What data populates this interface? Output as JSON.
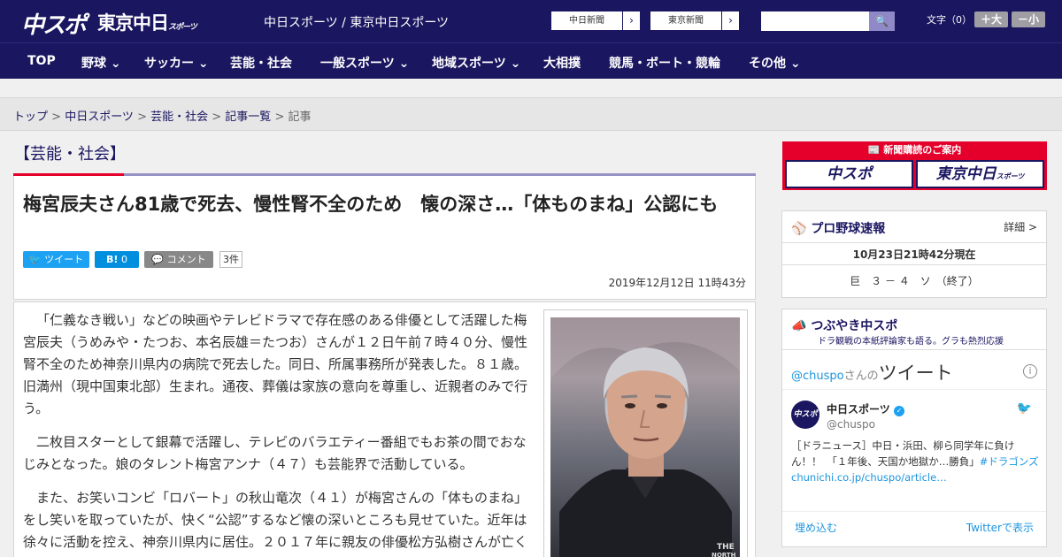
{
  "header": {
    "logo_main": "中スポ",
    "logo_tokyo": "東京中日",
    "logo_tokyo_sub": "スポーツ",
    "site_name": "中日スポーツ / 東京中日スポーツ",
    "paper1": "中日新聞",
    "paper2": "東京新聞",
    "paper_arrow": "›",
    "search_icon": "🔍",
    "font_label": "文字（0）",
    "font_plus": "＋大",
    "font_minus": "－小"
  },
  "nav": {
    "items": [
      "TOP",
      "野球",
      "サッカー",
      "芸能・社会",
      "一般スポーツ",
      "地域スポーツ",
      "大相撲",
      "競馬・ボート・競輪",
      "その他"
    ],
    "chevron": "⌄"
  },
  "breadcrumb": {
    "items": [
      "トップ",
      "中日スポーツ",
      "芸能・社会",
      "記事一覧"
    ],
    "separator": " > ",
    "current": "記事"
  },
  "article": {
    "category": "【芸能・社会】",
    "title": "梅宮辰夫さん81歳で死去、慢性腎不全のため　懐の深さ…「体ものまね」公認にも",
    "tweet_label": "ツイート",
    "hatena_label": "B!",
    "hatena_count": "0",
    "comment_label": "コメント",
    "comment_count": "3件",
    "date": "2019年12月12日 11時43分",
    "paragraphs": [
      "「仁義なき戦い」などの映画やテレビドラマで存在感のある俳優として活躍した梅宮辰夫（うめみや・たつお、本名辰雄＝たつお）さんが１２日午前７時４０分、慢性腎不全のため神奈川県内の病院で死去した。同日、所属事務所が発表した。８１歳。旧満州（現中国東北部）生まれ。通夜、葬儀は家族の意向を尊重し、近親者のみで行う。",
      "二枚目スターとして銀幕で活躍し、テレビのバラエティー番組でもお茶の間でおなじみとなった。娘のタレント梅宮アンナ（４７）も芸能界で活動している。",
      "また、お笑いコンビ「ロバート」の秋山竜次（４１）が梅宮さんの「体ものまね」をし笑いを取っていたが、快く“公認”するなど懐の深いところも見せていた。近年は徐々に活動を控え、神奈川県内に居住。２０１７年に親友の俳優松方弘樹さんが亡くなった時も自宅近くで報道陣の取材に応じ、涙ながらに思い出を語った。"
    ]
  },
  "sidebar": {
    "promo_header": "新聞購読のご案内",
    "promo1": "中スポ",
    "promo2": "東京中日",
    "promo2_sub": "スポーツ",
    "baseball": {
      "title": "プロ野球速報",
      "detail": "詳細 >",
      "time": "10月23日21時42分現在",
      "score": "巨　３ － ４　ソ　（終了）"
    },
    "twitter": {
      "title": "つぶやき中スポ",
      "subtitle": "ドラ観戦の本紙評論家も語る。グラも熱烈応援",
      "handle_prefix": "@chuspo",
      "handle_suffix": "さんの",
      "tweets_word": "ツイート",
      "name": "中日スポーツ",
      "screen_name": "@chuspo",
      "tweet": "［ドラニュース］中日・浜田、柳ら同学年に負けん！！　「１年後、天国か地獄か…勝負」",
      "tweet_link": "#ドラゴンズchunichi.co.jp/chuspo/article…",
      "embed": "埋め込む",
      "view": "Twitterで表示"
    }
  }
}
